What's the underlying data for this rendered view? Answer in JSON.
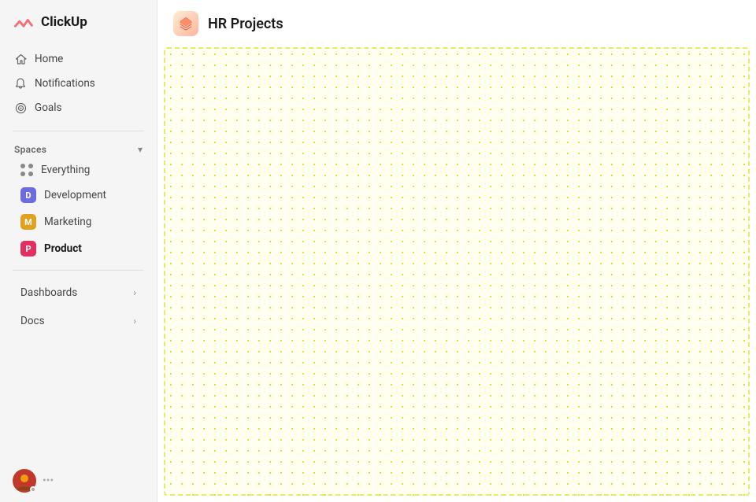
{
  "logo": {
    "text": "ClickUp"
  },
  "nav": {
    "home_label": "Home",
    "notifications_label": "Notifications",
    "goals_label": "Goals"
  },
  "spaces": {
    "header_label": "Spaces",
    "items": [
      {
        "id": "everything",
        "label": "Everything",
        "type": "dots"
      },
      {
        "id": "development",
        "label": "Development",
        "type": "badge",
        "badge_letter": "D",
        "badge_color": "#6c6ce0"
      },
      {
        "id": "marketing",
        "label": "Marketing",
        "type": "badge",
        "badge_letter": "M",
        "badge_color": "#e0a020"
      },
      {
        "id": "product",
        "label": "Product",
        "type": "badge",
        "badge_letter": "P",
        "badge_color": "#e03060",
        "active": true
      }
    ]
  },
  "sections": {
    "dashboards_label": "Dashboards",
    "docs_label": "Docs"
  },
  "page": {
    "title": "HR Projects",
    "icon": "📦"
  }
}
